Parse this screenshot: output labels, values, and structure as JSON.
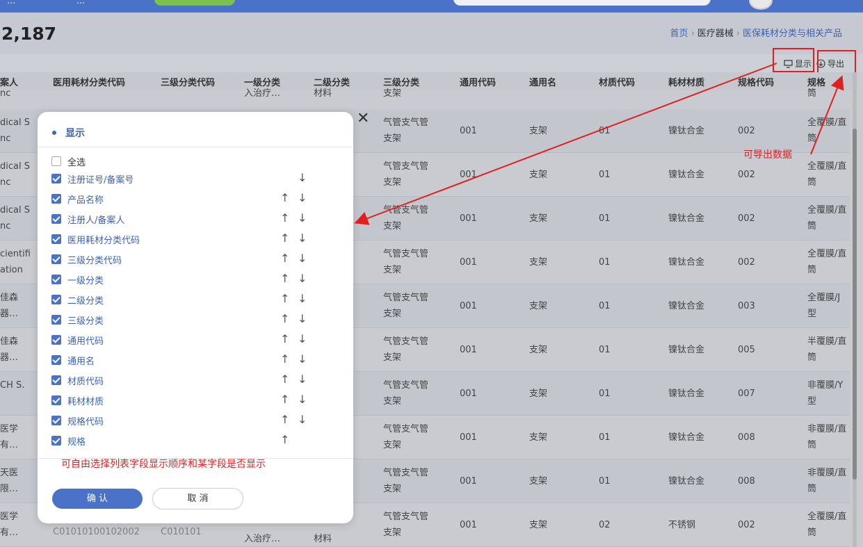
{
  "topbar": {
    "nav1": "...",
    "nav2": "..."
  },
  "header": {
    "total": "2,187",
    "breadcrumb": [
      "首页",
      "医疗器械",
      "医保耗材分类与相关产品"
    ]
  },
  "toolbar": {
    "display_label": "显示",
    "export_label": "导出"
  },
  "table": {
    "headers": [
      "案人",
      "医用耗材分类代码",
      "三级分类代码",
      "一级分类",
      "二级分类",
      "三级分类",
      "通用代码",
      "通用名",
      "材质代码",
      "耗材材质",
      "规格代码",
      "规格"
    ],
    "top_partial": {
      "col0": "nc",
      "yiji": "入治疗…",
      "erji": "材料",
      "sanji": "支架",
      "guige": "筒"
    },
    "rows": [
      {
        "c0": [
          "dical S",
          "nc"
        ],
        "sanji": [
          "气管支气管",
          "支架"
        ],
        "code": "001",
        "name": "支架",
        "mat": "01",
        "material": "镍钛合金",
        "spec": "002",
        "guige": [
          "全覆膜/直",
          "筒"
        ]
      },
      {
        "c0": [
          "dical S",
          "nc"
        ],
        "sanji": [
          "气管支气管",
          "支架"
        ],
        "code": "001",
        "name": "支架",
        "mat": "01",
        "material": "镍钛合金",
        "spec": "002",
        "guige": [
          "全覆膜/直",
          "筒"
        ]
      },
      {
        "c0": [
          "dical S",
          "nc"
        ],
        "sanji": [
          "气管支气管",
          "支架"
        ],
        "code": "001",
        "name": "支架",
        "mat": "01",
        "material": "镍钛合金",
        "spec": "002",
        "guige": [
          "全覆膜/直",
          "筒"
        ]
      },
      {
        "c0": [
          "cientifi",
          "ation"
        ],
        "sanji": [
          "气管支气管",
          "支架"
        ],
        "code": "001",
        "name": "支架",
        "mat": "01",
        "material": "镍钛合金",
        "spec": "002",
        "guige": [
          "全覆膜/直",
          "筒"
        ]
      },
      {
        "c0": [
          "佳森",
          "器…"
        ],
        "sanji": [
          "气管支气管",
          "支架"
        ],
        "code": "001",
        "name": "支架",
        "mat": "01",
        "material": "镍钛合金",
        "spec": "003",
        "guige": [
          "全覆膜/J",
          "型"
        ]
      },
      {
        "c0": [
          "佳森",
          "器…"
        ],
        "sanji": [
          "气管支气管",
          "支架"
        ],
        "code": "001",
        "name": "支架",
        "mat": "01",
        "material": "镍钛合金",
        "spec": "005",
        "guige": [
          "半覆膜/直",
          "筒"
        ]
      },
      {
        "c0": [
          "CH S.",
          ""
        ],
        "sanji": [
          "气管支气管",
          "支架"
        ],
        "code": "001",
        "name": "支架",
        "mat": "01",
        "material": "镍钛合金",
        "spec": "007",
        "guige": [
          "非覆膜/Y",
          "型"
        ]
      },
      {
        "c0": [
          "医学",
          "有…"
        ],
        "sanji": [
          "气管支气管",
          "支架"
        ],
        "code": "001",
        "name": "支架",
        "mat": "01",
        "material": "镍钛合金",
        "spec": "008",
        "guige": [
          "非覆膜/直",
          "筒"
        ]
      },
      {
        "c0": [
          "天医",
          "限…"
        ],
        "sanji": [
          "气管支气管",
          "支架"
        ],
        "code": "001",
        "name": "支架",
        "mat": "01",
        "material": "镍钛合金",
        "spec": "008",
        "guige": [
          "非覆膜/直",
          "筒"
        ]
      },
      {
        "c0": [
          "医学",
          "有…"
        ],
        "c1": "C0101010010200​2",
        "c2": "C010101",
        "yiji": "入治疗…",
        "erji": "材料",
        "sanji": [
          "气管支气管",
          "支架"
        ],
        "code": "001",
        "name": "支架",
        "mat": "02",
        "material": "不锈钢",
        "spec": "002",
        "guige": [
          "全覆膜/直",
          "筒"
        ]
      }
    ]
  },
  "modal": {
    "title": "显示",
    "select_all": "全选",
    "options": [
      "注册证号/备案号",
      "产品名称",
      "注册人/备案人",
      "医用耗材分类代码",
      "三级分类代码",
      "一级分类",
      "二级分类",
      "三级分类",
      "通用代码",
      "通用名",
      "材质代码",
      "耗材材质",
      "规格代码",
      "规格"
    ],
    "note": "可自由选择列表字段显示顺序和某字段是否显示",
    "ok": "确 认",
    "cancel": "取 消",
    "up_arrow": "↑",
    "down_arrow": "↓",
    "close": "✕"
  },
  "annotations": {
    "export_note": "可导出数据"
  },
  "colors": {
    "accent": "#4a72c9",
    "annotation_red": "#e02020"
  }
}
